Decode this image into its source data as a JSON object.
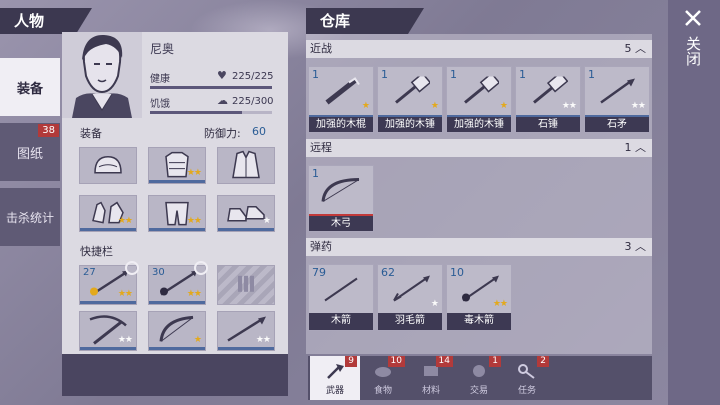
{
  "character_panel": {
    "title": "人物",
    "name": "尼奥",
    "health_label": "健康",
    "health_value": "225/225",
    "health_fraction": 1.0,
    "hunger_label": "饥饿",
    "hunger_value": "225/300",
    "hunger_fraction": 0.75,
    "equipment_label": "装备",
    "defense_label": "防御力:",
    "defense_value": "60",
    "quickbar_label": "快捷栏"
  },
  "side_tabs": [
    {
      "label": "装备",
      "active": true
    },
    {
      "label": "图纸",
      "badge": "38"
    },
    {
      "label": "击杀统计"
    }
  ],
  "equipment_slots": [
    {
      "icon": "helmet-icon",
      "stars": 0
    },
    {
      "icon": "armor-icon",
      "stars": 2
    },
    {
      "icon": "jacket-icon",
      "stars": 0
    },
    {
      "icon": "gloves-icon",
      "stars": 2
    },
    {
      "icon": "pants-icon",
      "stars": 2
    },
    {
      "icon": "boots-icon",
      "stars": 1,
      "star_color": "white"
    }
  ],
  "quickbar_slots": [
    {
      "count": "27",
      "icon": "fire-arrow-icon",
      "stars": 2
    },
    {
      "count": "30",
      "icon": "arrow-icon",
      "stars": 2
    },
    {
      "icon": "ammo-locked-icon",
      "stars": 0
    },
    {
      "icon": "crossbow-icon",
      "stars": 2,
      "star_color": "white"
    },
    {
      "icon": "bow-icon",
      "stars": 1
    },
    {
      "icon": "spear-icon",
      "stars": 2,
      "star_color": "white"
    }
  ],
  "warehouse": {
    "title": "仓库",
    "close_label": "关闭",
    "sections": [
      {
        "name": "近战",
        "count": "5",
        "items": [
          {
            "count": "1",
            "name": "加强的木棍",
            "stars": 1
          },
          {
            "count": "1",
            "name": "加强的木锤",
            "stars": 1
          },
          {
            "count": "1",
            "name": "加强的木锤",
            "stars": 1
          },
          {
            "count": "1",
            "name": "石锤",
            "stars": 2,
            "star_color": "white"
          },
          {
            "count": "1",
            "name": "石矛",
            "stars": 2,
            "star_color": "white"
          }
        ]
      },
      {
        "name": "远程",
        "count": "1",
        "items": [
          {
            "count": "1",
            "name": "木弓",
            "stars": 0
          }
        ]
      },
      {
        "name": "弹药",
        "count": "3",
        "items": [
          {
            "count": "79",
            "name": "木箭",
            "stars": 0
          },
          {
            "count": "62",
            "name": "羽毛箭",
            "stars": 1,
            "star_color": "white"
          },
          {
            "count": "10",
            "name": "毒木箭",
            "stars": 2
          }
        ]
      }
    ]
  },
  "bottom_tabs": [
    {
      "label": "武器",
      "badge": "9",
      "icon": "axe-icon"
    },
    {
      "label": "食物",
      "badge": "10",
      "icon": "food-icon"
    },
    {
      "label": "材料",
      "badge": "14",
      "icon": "material-icon"
    },
    {
      "label": "交易",
      "badge": "1",
      "icon": "trade-icon"
    },
    {
      "label": "任务",
      "badge": "2",
      "icon": "key-icon"
    }
  ]
}
